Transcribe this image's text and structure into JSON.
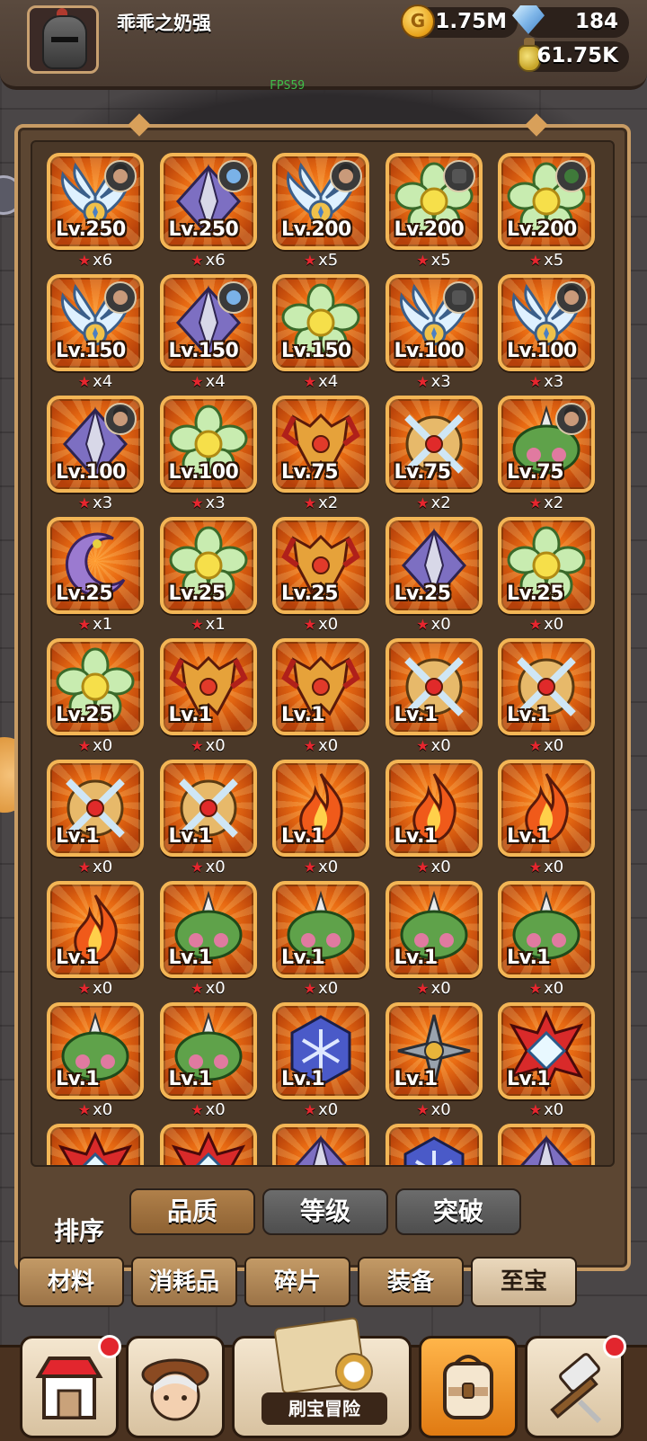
{
  "player": {
    "name": "乖乖之奶强",
    "gold": "1.75M",
    "gems": "184",
    "potion": "61.75K"
  },
  "debug": {
    "fps": "FPS59"
  },
  "items": [
    {
      "art": "wing",
      "lv": "Lv.250",
      "stars": "x6",
      "owner": "hat"
    },
    {
      "art": "spear",
      "lv": "Lv.250",
      "stars": "x6",
      "owner": "blue"
    },
    {
      "art": "wing",
      "lv": "Lv.200",
      "stars": "x5",
      "owner": "hat"
    },
    {
      "art": "flower",
      "lv": "Lv.200",
      "stars": "x5",
      "owner": "knight"
    },
    {
      "art": "flower",
      "lv": "Lv.200",
      "stars": "x5",
      "owner": "green"
    },
    {
      "art": "wing",
      "lv": "Lv.150",
      "stars": "x4",
      "owner": "face"
    },
    {
      "art": "spear",
      "lv": "Lv.150",
      "stars": "x4",
      "owner": "blue"
    },
    {
      "art": "flower",
      "lv": "Lv.150",
      "stars": "x4",
      "owner": ""
    },
    {
      "art": "wing",
      "lv": "Lv.100",
      "stars": "x3",
      "owner": "knight"
    },
    {
      "art": "wing",
      "lv": "Lv.100",
      "stars": "x3",
      "owner": "hat"
    },
    {
      "art": "spear",
      "lv": "Lv.100",
      "stars": "x3",
      "owner": "hat"
    },
    {
      "art": "flower",
      "lv": "Lv.100",
      "stars": "x3",
      "owner": ""
    },
    {
      "art": "crest",
      "lv": "Lv.75",
      "stars": "x2",
      "owner": ""
    },
    {
      "art": "cross",
      "lv": "Lv.75",
      "stars": "x2",
      "owner": ""
    },
    {
      "art": "leaf",
      "lv": "Lv.75",
      "stars": "x2",
      "owner": "hat"
    },
    {
      "art": "moon",
      "lv": "Lv.25",
      "stars": "x1",
      "owner": ""
    },
    {
      "art": "flower",
      "lv": "Lv.25",
      "stars": "x1",
      "owner": ""
    },
    {
      "art": "crest",
      "lv": "Lv.25",
      "stars": "x0",
      "owner": ""
    },
    {
      "art": "spear",
      "lv": "Lv.25",
      "stars": "x0",
      "owner": ""
    },
    {
      "art": "flower",
      "lv": "Lv.25",
      "stars": "x0",
      "owner": ""
    },
    {
      "art": "flower",
      "lv": "Lv.25",
      "stars": "x0",
      "owner": ""
    },
    {
      "art": "crest",
      "lv": "Lv.1",
      "stars": "x0",
      "owner": ""
    },
    {
      "art": "crest",
      "lv": "Lv.1",
      "stars": "x0",
      "owner": ""
    },
    {
      "art": "cross",
      "lv": "Lv.1",
      "stars": "x0",
      "owner": ""
    },
    {
      "art": "cross",
      "lv": "Lv.1",
      "stars": "x0",
      "owner": ""
    },
    {
      "art": "cross",
      "lv": "Lv.1",
      "stars": "x0",
      "owner": ""
    },
    {
      "art": "cross",
      "lv": "Lv.1",
      "stars": "x0",
      "owner": ""
    },
    {
      "art": "fire",
      "lv": "Lv.1",
      "stars": "x0",
      "owner": ""
    },
    {
      "art": "fire",
      "lv": "Lv.1",
      "stars": "x0",
      "owner": ""
    },
    {
      "art": "fire",
      "lv": "Lv.1",
      "stars": "x0",
      "owner": ""
    },
    {
      "art": "fire",
      "lv": "Lv.1",
      "stars": "x0",
      "owner": ""
    },
    {
      "art": "leaf",
      "lv": "Lv.1",
      "stars": "x0",
      "owner": ""
    },
    {
      "art": "leaf",
      "lv": "Lv.1",
      "stars": "x0",
      "owner": ""
    },
    {
      "art": "leaf",
      "lv": "Lv.1",
      "stars": "x0",
      "owner": ""
    },
    {
      "art": "leaf",
      "lv": "Lv.1",
      "stars": "x0",
      "owner": ""
    },
    {
      "art": "leaf",
      "lv": "Lv.1",
      "stars": "x0",
      "owner": ""
    },
    {
      "art": "leaf",
      "lv": "Lv.1",
      "stars": "x0",
      "owner": ""
    },
    {
      "art": "snow",
      "lv": "Lv.1",
      "stars": "x0",
      "owner": ""
    },
    {
      "art": "shuriken",
      "lv": "Lv.1",
      "stars": "x0",
      "owner": ""
    },
    {
      "art": "diamond",
      "lv": "Lv.1",
      "stars": "x0",
      "owner": ""
    },
    {
      "art": "diamond",
      "lv": "",
      "stars": "",
      "owner": ""
    },
    {
      "art": "diamond",
      "lv": "",
      "stars": "",
      "owner": ""
    },
    {
      "art": "spear",
      "lv": "",
      "stars": "",
      "owner": ""
    },
    {
      "art": "snow",
      "lv": "",
      "stars": "",
      "owner": ""
    },
    {
      "art": "spear",
      "lv": "",
      "stars": "",
      "owner": ""
    }
  ],
  "sort": {
    "label": "排序",
    "options": [
      "品质",
      "等级",
      "突破"
    ],
    "active": "品质"
  },
  "tabs": {
    "items": [
      "材料",
      "消耗品",
      "碎片",
      "装备",
      "至宝"
    ],
    "selected": "至宝"
  },
  "bottom_nav": {
    "center_label": "刷宝冒险",
    "icons": [
      "shop-icon",
      "hero-icon",
      "treasure-map-icon",
      "backpack-icon",
      "forge-icon"
    ]
  }
}
